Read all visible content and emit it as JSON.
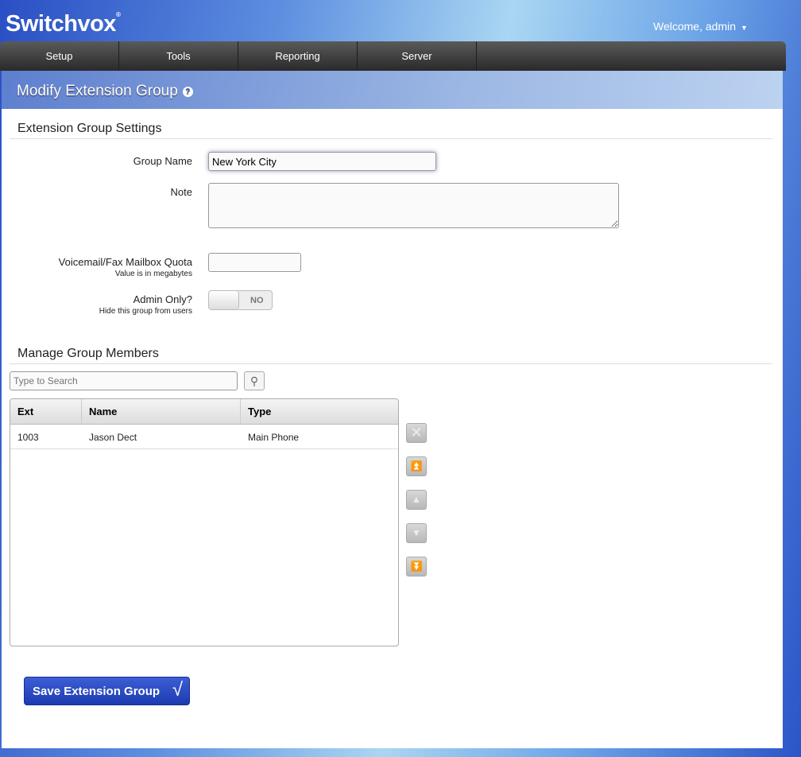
{
  "header": {
    "logo": "Switchvox",
    "welcome": "Welcome, admin"
  },
  "nav": [
    "Setup",
    "Tools",
    "Reporting",
    "Server"
  ],
  "page": {
    "title": "Modify Extension Group"
  },
  "settings": {
    "section": "Extension Group Settings",
    "group_name_label": "Group Name",
    "group_name_value": "New York City",
    "note_label": "Note",
    "note_value": "",
    "quota_label": "Voicemail/Fax Mailbox Quota",
    "quota_hint": "Value is in megabytes",
    "quota_value": "",
    "admin_label": "Admin Only?",
    "admin_hint": "Hide this group from users",
    "admin_value": "NO"
  },
  "members": {
    "section": "Manage Group Members",
    "search_placeholder": "Type to Search",
    "columns": [
      "Ext",
      "Name",
      "Type"
    ],
    "rows": [
      {
        "ext": "1003",
        "name": "Jason Dect",
        "type": "Main Phone"
      }
    ]
  },
  "save_label": "Save Extension Group"
}
